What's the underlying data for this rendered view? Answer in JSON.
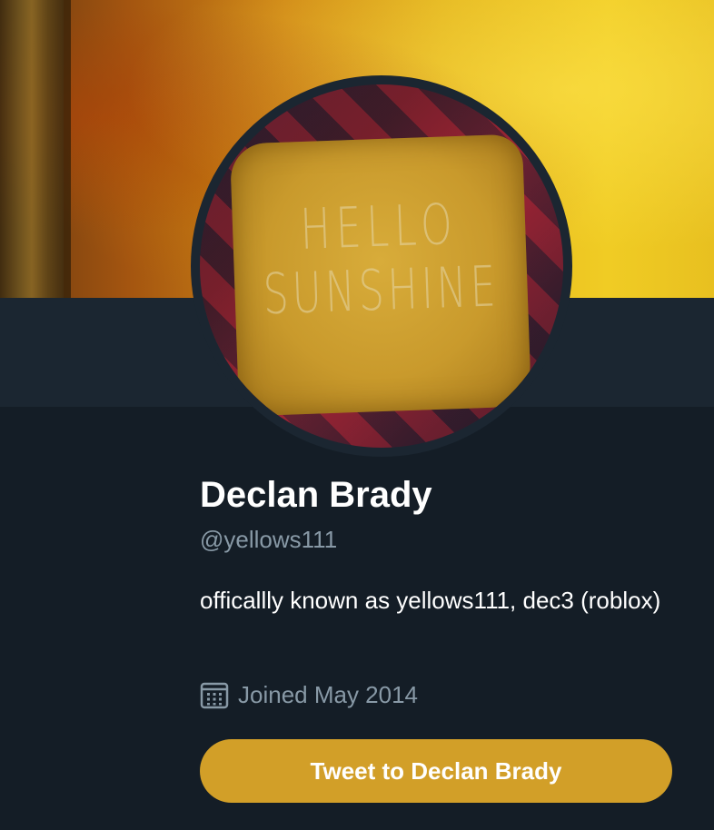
{
  "profile": {
    "display_name": "Declan Brady",
    "handle": "@yellows111",
    "bio": "officallly known as yellows111, dec3 (roblox)",
    "joined": "Joined May 2014",
    "avatar_text_line1": "HELLO",
    "avatar_text_line2": "SUNSHINE"
  },
  "actions": {
    "tweet_to_label": "Tweet to Declan Brady"
  },
  "icons": {
    "joined": "calendar-icon"
  },
  "colors": {
    "background": "#141d26",
    "band": "#1b2631",
    "secondary_text": "#8899a6",
    "accent_button": "#d29f28"
  }
}
